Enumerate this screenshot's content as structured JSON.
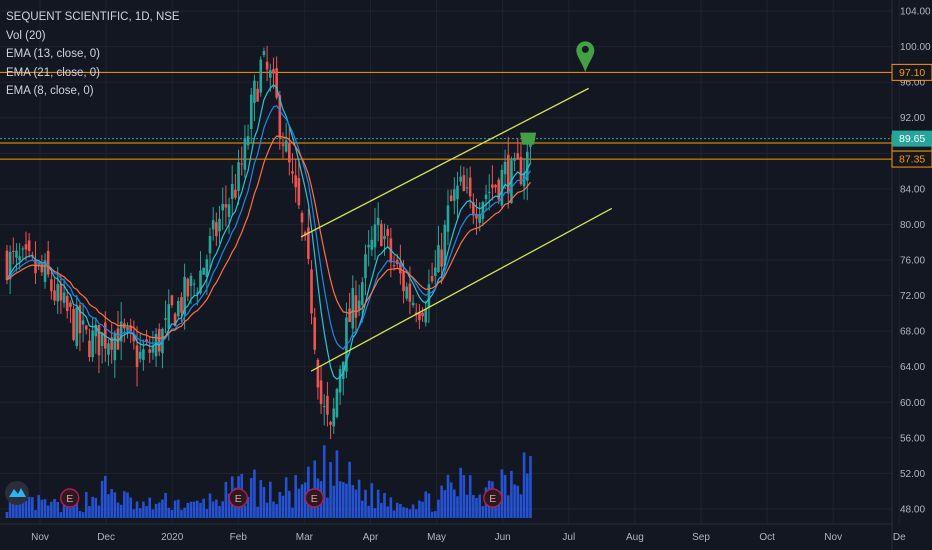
{
  "legend": {
    "symbol": "SEQUENT SCIENTIFIC, 1D, NSE",
    "vol": "Vol (20)",
    "ema13": "EMA (13, close, 0)",
    "ema21": "EMA (21, close, 0)",
    "ema8": "EMA (8, close, 0)"
  },
  "colors": {
    "background": "#131722",
    "up": "#26a69a",
    "down": "#ef5350",
    "volume": "#2962ff",
    "ema_fast": "#26c6da",
    "ema_mid": "#1e88e5",
    "ema_slow": "#ff7043",
    "trendline": "#d4e157",
    "level": "#ff9800",
    "price_line": "#26a69a",
    "marker": "#43a047"
  },
  "chart_data": {
    "type": "candlestick",
    "y_axis": {
      "min": 48,
      "max": 104,
      "ticks": [
        "104.00",
        "100.00",
        "96.00",
        "92.00",
        "88.00",
        "84.00",
        "80.00",
        "76.00",
        "72.00",
        "68.00",
        "64.00",
        "60.00",
        "56.00",
        "52.00",
        "48.00"
      ]
    },
    "x_axis": {
      "ticks": [
        "Nov",
        "Dec",
        "2020",
        "Feb",
        "Mar",
        "Apr",
        "May",
        "Jun",
        "Jul",
        "Aug",
        "Sep",
        "Oct",
        "Nov",
        "De"
      ],
      "tick_months_index": [
        0,
        1,
        2,
        3,
        4,
        5,
        6,
        7,
        8,
        9,
        10,
        11,
        12,
        13
      ]
    },
    "horizontal_levels": [
      {
        "label": "97.10",
        "value": 97.1,
        "style": "level"
      },
      {
        "label": "89.15",
        "value": 89.15,
        "style": "level"
      },
      {
        "label": "87.35",
        "value": 87.35,
        "style": "level"
      },
      {
        "label": "89.65",
        "value": 89.65,
        "style": "current"
      }
    ],
    "trendlines": [
      {
        "from": [
          3.95,
          78.6
        ],
        "to": [
          8.3,
          95.3
        ]
      },
      {
        "from": [
          4.1,
          63.5
        ],
        "to": [
          8.65,
          81.8
        ]
      }
    ],
    "close_path": [
      [
        -0.5,
        76
      ],
      [
        -0.3,
        75.5
      ],
      [
        -0.1,
        75
      ],
      [
        0.1,
        74
      ],
      [
        0.3,
        71
      ],
      [
        0.5,
        69
      ],
      [
        0.7,
        67
      ],
      [
        0.9,
        67
      ],
      [
        1.1,
        68
      ],
      [
        1.3,
        67
      ],
      [
        1.5,
        65
      ],
      [
        1.7,
        66
      ],
      [
        1.9,
        68
      ],
      [
        2.0,
        70
      ],
      [
        2.2,
        72
      ],
      [
        2.4,
        74
      ],
      [
        2.6,
        78
      ],
      [
        2.8,
        82
      ],
      [
        3.0,
        85
      ],
      [
        3.1,
        88
      ],
      [
        3.2,
        93
      ],
      [
        3.35,
        98
      ],
      [
        3.5,
        96
      ],
      [
        3.65,
        91
      ],
      [
        3.8,
        85
      ],
      [
        3.95,
        80
      ],
      [
        4.1,
        72
      ],
      [
        4.25,
        60
      ],
      [
        4.4,
        56
      ],
      [
        4.55,
        65
      ],
      [
        4.7,
        70
      ],
      [
        4.85,
        73
      ],
      [
        5.0,
        77
      ],
      [
        5.15,
        80
      ],
      [
        5.3,
        76
      ],
      [
        5.45,
        74
      ],
      [
        5.6,
        72
      ],
      [
        5.75,
        71
      ],
      [
        5.9,
        73
      ],
      [
        6.05,
        76
      ],
      [
        6.2,
        82
      ],
      [
        6.35,
        84
      ],
      [
        6.5,
        82
      ],
      [
        6.65,
        83
      ],
      [
        6.8,
        84
      ],
      [
        6.95,
        85
      ],
      [
        7.05,
        86
      ],
      [
        7.15,
        85
      ],
      [
        7.25,
        86
      ],
      [
        7.35,
        87
      ],
      [
        7.45,
        89.65
      ]
    ],
    "volume_profile": [
      [
        -0.5,
        0.3
      ],
      [
        0.5,
        0.2
      ],
      [
        1.0,
        0.5
      ],
      [
        1.5,
        0.2
      ],
      [
        2.0,
        0.3
      ],
      [
        2.3,
        0.2
      ],
      [
        2.8,
        0.4
      ],
      [
        3.0,
        0.5
      ],
      [
        3.2,
        0.6
      ],
      [
        3.5,
        0.4
      ],
      [
        4.0,
        0.5
      ],
      [
        4.3,
        0.8
      ],
      [
        4.6,
        0.7
      ],
      [
        5.0,
        0.4
      ],
      [
        5.5,
        0.3
      ],
      [
        6.0,
        0.3
      ],
      [
        6.3,
        0.6
      ],
      [
        6.6,
        0.5
      ],
      [
        6.9,
        0.6
      ],
      [
        7.1,
        0.9
      ],
      [
        7.35,
        1.0
      ],
      [
        7.45,
        0.8
      ]
    ],
    "event_badges": [
      {
        "label": "E",
        "month": 0.45
      },
      {
        "label": "E",
        "month": 3.0
      },
      {
        "label": "E",
        "month": 4.15
      },
      {
        "label": "E",
        "month": 6.85
      }
    ],
    "marker": {
      "month": 8.25,
      "value": 97.1
    },
    "flag": {
      "month": 7.4,
      "value": 89.65
    }
  }
}
